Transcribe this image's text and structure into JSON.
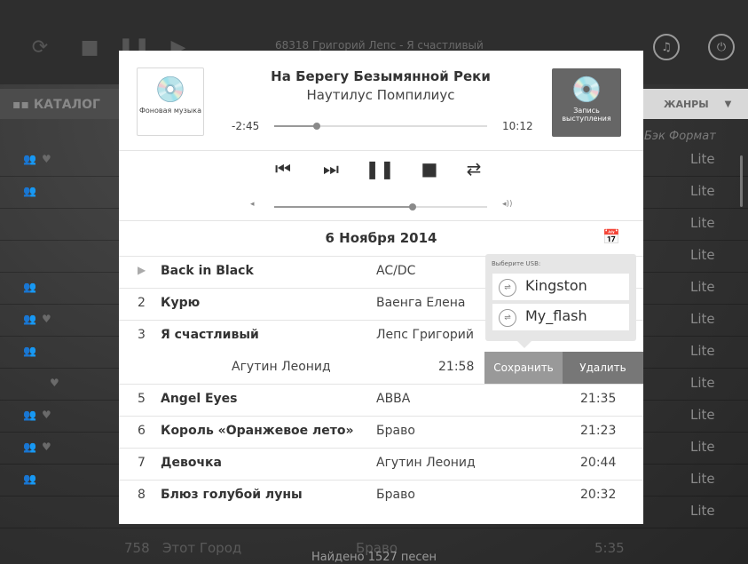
{
  "background": {
    "now_playing_title": "68318  Григорий Лепс - Я счастливый",
    "catalog_label": "КАТАЛОГ",
    "genres_label": "ЖАНРЫ",
    "column_headers": "Бэк  Формат",
    "format_value": "Lite",
    "last_row": {
      "num": "758",
      "title": "Этот Город",
      "artist": "Браво",
      "time": "5:35"
    },
    "footer_text": "Найдено 1527 песен"
  },
  "player": {
    "bg_music_label": "Фоновая музыка",
    "record_label": "Запись выступления",
    "song_title": "На Берегу Безымянной Реки",
    "artist": "Наутилус Помпилиус",
    "time_remaining": "-2:45",
    "duration": "10:12",
    "progress_fraction": 0.2,
    "volume_fraction": 0.65
  },
  "playlist": {
    "date": "6 Ноября 2014",
    "rows": [
      {
        "num": "",
        "title": "Back in Black",
        "artist": "AC/DC",
        "time": ""
      },
      {
        "num": "2",
        "title": "Курю",
        "artist": "Ваенга Елена",
        "time": ""
      },
      {
        "num": "3",
        "title": "Я счастливый",
        "artist": "Лепс Григорий",
        "time": ""
      },
      {
        "num": "",
        "title": "",
        "artist": "Агутин Леонид",
        "time": "21:58"
      },
      {
        "num": "5",
        "title": "Angel Eyes",
        "artist": "ABBA",
        "time": "21:35"
      },
      {
        "num": "6",
        "title": "Король «Оранжевое лето»",
        "artist": "Браво",
        "time": "21:23"
      },
      {
        "num": "7",
        "title": "Девочка",
        "artist": "Агутин Леонид",
        "time": "20:44"
      },
      {
        "num": "8",
        "title": "Блюз голубой луны",
        "artist": "Браво",
        "time": "20:32"
      }
    ],
    "save_label": "Сохранить",
    "delete_label": "Удалить"
  },
  "usb_popup": {
    "header": "Выберите USB:",
    "devices": [
      "Kingston",
      "My_flash"
    ]
  }
}
